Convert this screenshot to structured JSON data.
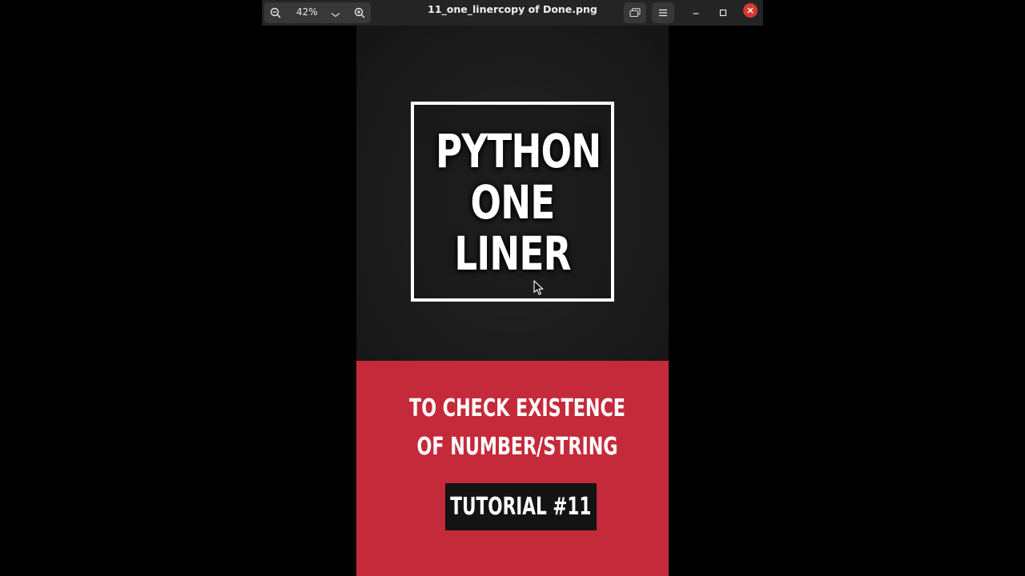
{
  "window": {
    "title": "11_one_linercopy of Done.png",
    "zoom": "42%"
  },
  "colors": {
    "titlebar": "#242424",
    "button": "#383838",
    "close": "#d63a30",
    "dark_bg": "#1c1c1c",
    "accent_red": "#c52a3a",
    "badge_bg": "#131313"
  },
  "icons": {
    "zoom_out": "zoom-out-icon",
    "zoom_caret": "chevron-down-icon",
    "zoom_in": "zoom-in-icon",
    "gallery": "gallery-icon",
    "menu": "hamburger-menu-icon",
    "minimize": "minimize-icon",
    "maximize": "maximize-icon",
    "close": "close-icon",
    "cursor": "mouse-pointer-icon"
  },
  "image": {
    "headline": [
      "PYTHON",
      "ONE",
      "LINER"
    ],
    "subtitle": [
      "TO CHECK EXISTENCE",
      "OF NUMBER/STRING"
    ],
    "badge": "TUTORIAL #11"
  }
}
